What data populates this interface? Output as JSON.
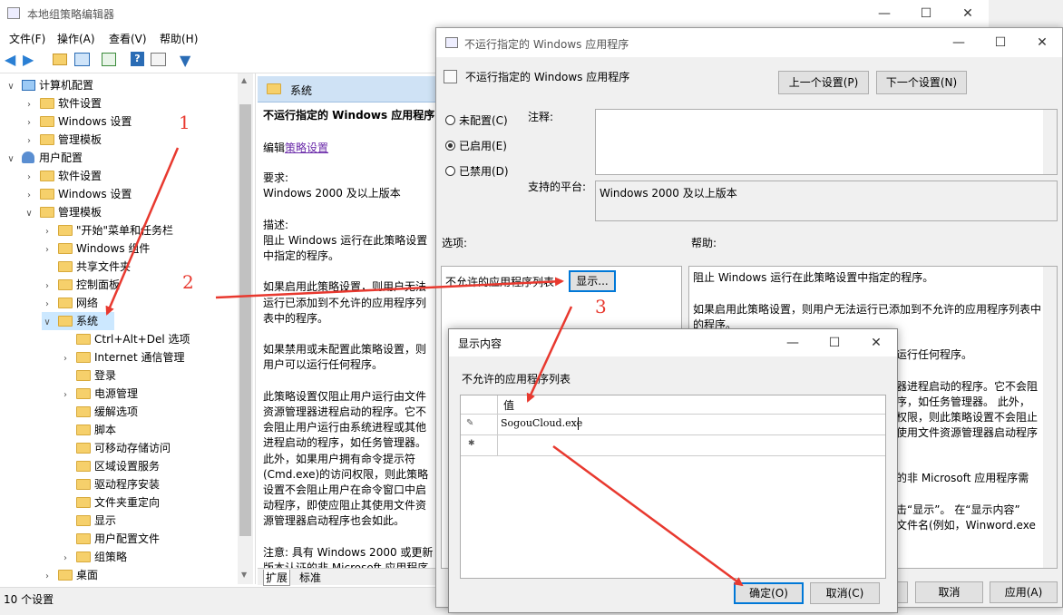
{
  "main": {
    "title": "本地组策略编辑器",
    "menu": [
      "文件(F)",
      "操作(A)",
      "查看(V)",
      "帮助(H)"
    ],
    "status": "10 个设置",
    "tree": [
      {
        "label": "计算机配置",
        "level": 0,
        "exp": "down",
        "icon": "computer"
      },
      {
        "label": "软件设置",
        "level": 1,
        "exp": "right"
      },
      {
        "label": "Windows 设置",
        "level": 1,
        "exp": "right"
      },
      {
        "label": "管理模板",
        "level": 1,
        "exp": "right"
      },
      {
        "label": "用户配置",
        "level": 0,
        "exp": "down",
        "icon": "user"
      },
      {
        "label": "软件设置",
        "level": 1,
        "exp": "right"
      },
      {
        "label": "Windows 设置",
        "level": 1,
        "exp": "right"
      },
      {
        "label": "管理模板",
        "level": 1,
        "exp": "down"
      },
      {
        "label": "\"开始\"菜单和任务栏",
        "level": 2,
        "exp": "right"
      },
      {
        "label": "Windows 组件",
        "level": 2,
        "exp": "right"
      },
      {
        "label": "共享文件夹",
        "level": 2,
        "exp": ""
      },
      {
        "label": "控制面板",
        "level": 2,
        "exp": "right"
      },
      {
        "label": "网络",
        "level": 2,
        "exp": "right"
      },
      {
        "label": "系统",
        "level": 2,
        "exp": "down",
        "selected": true
      },
      {
        "label": "Ctrl+Alt+Del 选项",
        "level": 3,
        "exp": ""
      },
      {
        "label": "Internet 通信管理",
        "level": 3,
        "exp": "right"
      },
      {
        "label": "登录",
        "level": 3,
        "exp": ""
      },
      {
        "label": "电源管理",
        "level": 3,
        "exp": "right"
      },
      {
        "label": "缓解选项",
        "level": 3,
        "exp": ""
      },
      {
        "label": "脚本",
        "level": 3,
        "exp": ""
      },
      {
        "label": "可移动存储访问",
        "level": 3,
        "exp": ""
      },
      {
        "label": "区域设置服务",
        "level": 3,
        "exp": ""
      },
      {
        "label": "驱动程序安装",
        "level": 3,
        "exp": ""
      },
      {
        "label": "文件夹重定向",
        "level": 3,
        "exp": ""
      },
      {
        "label": "显示",
        "level": 3,
        "exp": ""
      },
      {
        "label": "用户配置文件",
        "level": 3,
        "exp": ""
      },
      {
        "label": "组策略",
        "level": 3,
        "exp": "right"
      },
      {
        "label": "桌面",
        "level": 2,
        "exp": "right"
      }
    ],
    "desc_header": "系统",
    "desc_title": "不运行指定的 Windows 应用程序",
    "desc_edit_prefix": "编辑",
    "desc_edit_link": "策略设置",
    "desc_body": "要求:\nWindows 2000 及以上版本\n\n描述:\n阻止 Windows 运行在此策略设置\n中指定的程序。\n\n如果启用此策略设置，则用户无法\n运行已添加到不允许的应用程序列\n表中的程序。\n\n如果禁用或未配置此策略设置，则\n用户可以运行任何程序。\n\n此策略设置仅阻止用户运行由文件\n资源管理器进程启动的程序。它不\n会阻止用户运行由系统进程或其他\n进程启动的程序，如任务管理器。\n此外，如果用户拥有命令提示符\n(Cmd.exe)的访问权限，则此策略\n设置不会阻止用户在命令窗口中启\n动程序，即使应阻止其使用文件资\n源管理器启动程序也会如此。\n\n注意: 具有 Windows 2000 或更新\n版本认证的非 Microsoft 应用程序",
    "tabs": [
      "扩展",
      "标准"
    ]
  },
  "policy": {
    "title": "不运行指定的 Windows 应用程序",
    "heading": "不运行指定的 Windows 应用程序",
    "prev_button": "上一个设置(P)",
    "next_button": "下一个设置(N)",
    "radio_not_configured": "未配置(C)",
    "radio_enabled": "已启用(E)",
    "radio_disabled": "已禁用(D)",
    "comment_label": "注释:",
    "platform_label": "支持的平台:",
    "platform_value": "Windows 2000 及以上版本",
    "options_label": "选项:",
    "help_label": "帮助:",
    "option_list_label": "不允许的应用程序列表",
    "show_button": "显示...",
    "help_line1": "阻止 Windows 运行在此策略设置中指定的程序。",
    "help_line2": "如果启用此策略设置，则用户无法运行已添加到不允许的应用程序列表中",
    "help_line3": "的程序。",
    "help_frag1": "运行任何程序。",
    "help_frag2": "器进程启动的程序。它不会阻",
    "help_frag3": "序，如任务管理器。 此外，",
    "help_frag4": "权限，则此策略设置不会阻止",
    "help_frag5": "使用文件资源管理器启动程序",
    "help_frag6": "的非 Microsoft 应用程序需",
    "help_frag7": "击“显示”。 在“显示内容”",
    "help_frag8": "文件名(例如，Winword.exe",
    "ok_button": "确定",
    "cancel_button": "取消",
    "apply_button": "应用(A)"
  },
  "dialog": {
    "title": "显示内容",
    "list_label": "不允许的应用程序列表",
    "column_header": "值",
    "row_value": "SogouCloud.exe",
    "ok_button": "确定(O)",
    "cancel_button": "取消(C)"
  },
  "annotations": [
    "1",
    "2",
    "3"
  ],
  "colors": {
    "accent": "#0078d7",
    "arrow": "#e8392f",
    "selection": "#cce8ff"
  }
}
